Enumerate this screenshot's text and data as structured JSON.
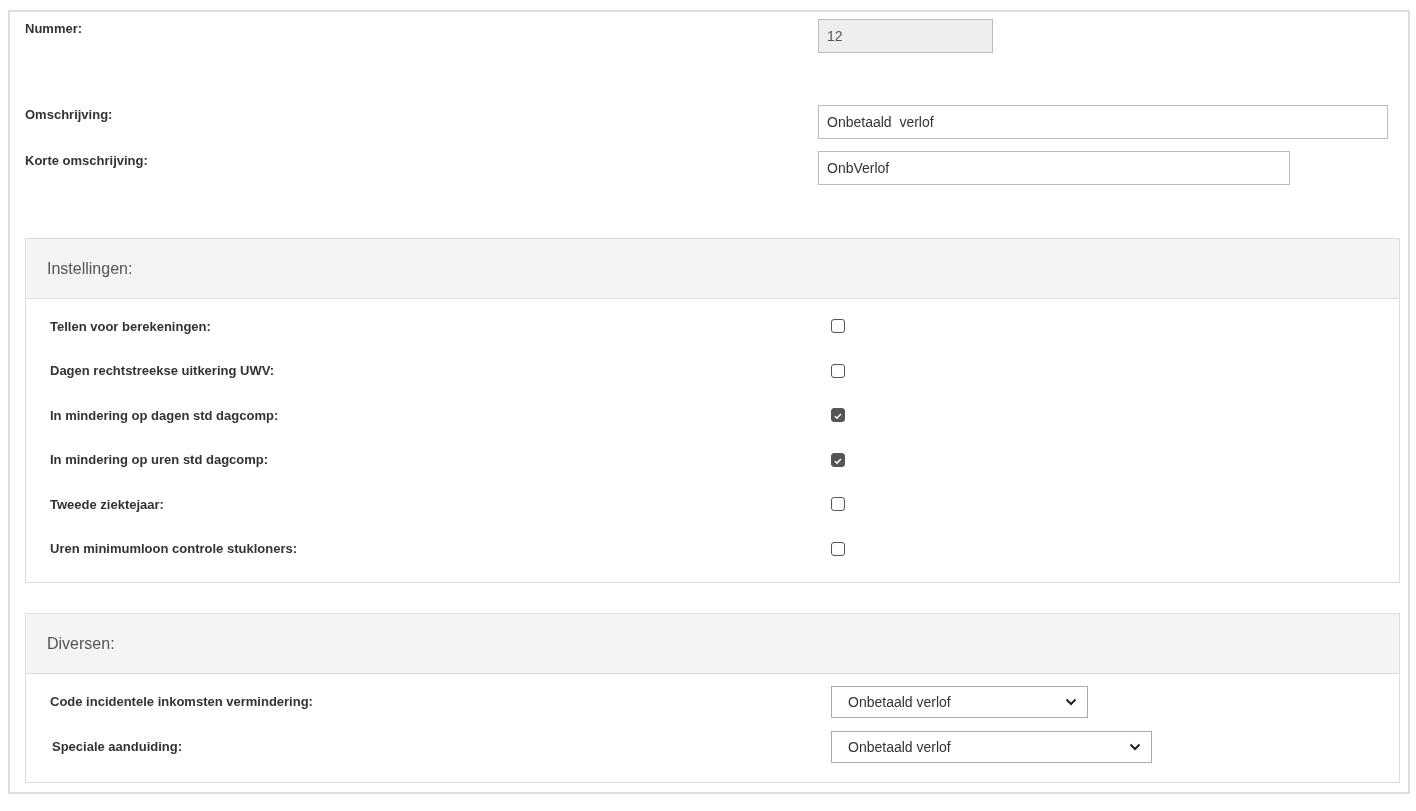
{
  "fields": [
    {
      "label": "Nummer:",
      "value": "12",
      "disabled": true
    },
    {
      "label": "Omschrijving:",
      "value": "Onbetaald  verlof",
      "disabled": false
    },
    {
      "label": "Korte omschrijving:",
      "value": "OnbVerlof",
      "disabled": false
    }
  ],
  "settings": {
    "title": "Instellingen:",
    "items": [
      {
        "label": "Tellen voor berekeningen:",
        "checked": false
      },
      {
        "label": "Dagen rechtstreekse uitkering UWV:",
        "checked": false
      },
      {
        "label": "In mindering op dagen std dagcomp:",
        "checked": true
      },
      {
        "label": "In mindering op uren std dagcomp:",
        "checked": true
      },
      {
        "label": "Tweede ziektejaar:",
        "checked": false
      },
      {
        "label": "Uren minimumloon controle stukloners:",
        "checked": false
      }
    ]
  },
  "misc": {
    "title": "Diversen:",
    "items": [
      {
        "label": "Code incidentele inkomsten vermindering:",
        "value": "Onbetaald verlof"
      },
      {
        "label": "Speciale aanduiding:",
        "value": "Onbetaald verlof"
      }
    ]
  }
}
